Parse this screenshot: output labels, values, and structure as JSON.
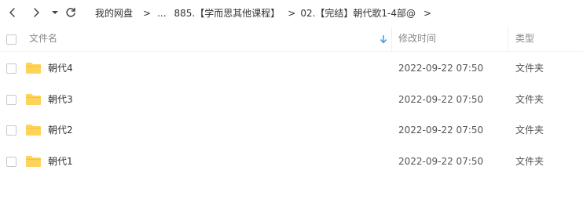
{
  "nav": {
    "breadcrumb": {
      "root": "我的网盘",
      "ellipsis": "...",
      "folder1": "885.【学而思其他课程】",
      "folder2": "02.【完结】朝代歌1-4部@",
      "separator": ">"
    }
  },
  "header": {
    "name_label": "文件名",
    "modified_label": "修改时间",
    "type_label": "类型"
  },
  "files": [
    {
      "name": "朝代4",
      "modified": "2022-09-22 07:50",
      "type": "文件夹"
    },
    {
      "name": "朝代3",
      "modified": "2022-09-22 07:50",
      "type": "文件夹"
    },
    {
      "name": "朝代2",
      "modified": "2022-09-22 07:50",
      "type": "文件夹"
    },
    {
      "name": "朝代1",
      "modified": "2022-09-22 07:50",
      "type": "文件夹"
    }
  ],
  "colors": {
    "folder": "#ffd35a",
    "sort_arrow": "#3ba0f5"
  },
  "icons": {
    "back": "chevron-left-icon",
    "forward": "chevron-right-icon",
    "history_dropdown": "caret-down-icon",
    "refresh": "refresh-icon",
    "sort": "sort-down-arrow-icon",
    "folder": "folder-icon"
  }
}
